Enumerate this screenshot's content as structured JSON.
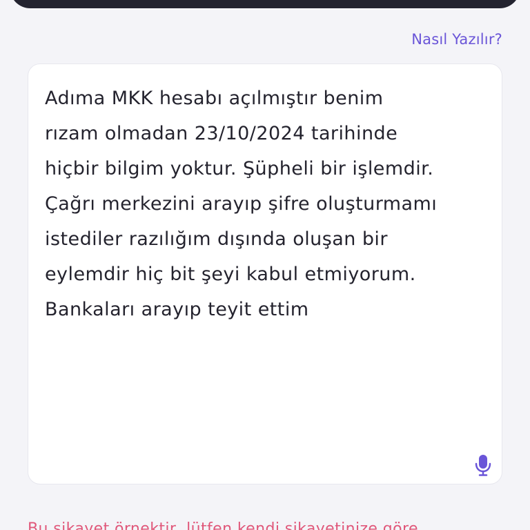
{
  "header": {
    "help_link": "Nasıl Yazılır?"
  },
  "complaint": {
    "text": "Adıma MKK hesabı açılmıştır benim\nrızam olmadan 23/10/2024 tarihinde\nhiçbir bilgim yoktur. Şüpheli bir işlemdir.\nÇağrı merkezini arayıp şifre oluşturmamı\nistediler razılığım dışında oluşan bir\neylemdir hiç bit şeyi kabul etmiyorum.\nBankaları arayıp teyit ettim"
  },
  "footer": {
    "sample_note": "Bu şikayet örnektir, lütfen kendi şikayetinize göre"
  },
  "icons": {
    "mic": "microphone-icon"
  },
  "colors": {
    "accent": "#6a55d8",
    "warning_text": "#e0577a",
    "top_bar": "#232330",
    "background": "#f4f4f8"
  }
}
